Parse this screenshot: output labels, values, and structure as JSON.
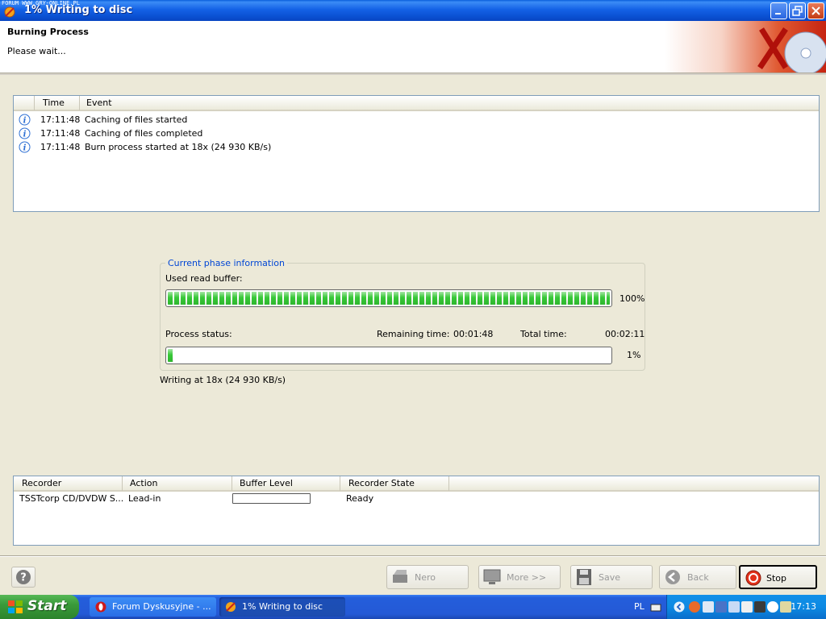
{
  "window": {
    "watermark": "FORUM WWW.GRY-ONLINE.PL",
    "title": "1% Writing to disc"
  },
  "header": {
    "title": "Burning Process",
    "subtitle": "Please wait..."
  },
  "event_log": {
    "columns": [
      "Time",
      "Event"
    ],
    "rows": [
      {
        "icon": "info-icon",
        "time": "17:11:48",
        "event": "Caching of files started"
      },
      {
        "icon": "info-icon",
        "time": "17:11:48",
        "event": "Caching of files completed"
      },
      {
        "icon": "info-icon",
        "time": "17:11:48",
        "event": "Burn process started at 18x (24 930 KB/s)"
      }
    ]
  },
  "phase": {
    "legend": "Current phase information",
    "buffer_label": "Used read buffer:",
    "buffer_percent_text": "100%",
    "buffer_fraction": 1.0,
    "status_label": "Process status:",
    "remaining_label": "Remaining time:",
    "remaining_value": "00:01:48",
    "total_label": "Total time:",
    "total_value": "00:02:11",
    "process_percent_text": "1%",
    "process_fraction": 0.01,
    "writing_text": "Writing at 18x (24 930 KB/s)"
  },
  "recorders": {
    "columns": [
      "Recorder",
      "Action",
      "Buffer Level",
      "Recorder State"
    ],
    "rows": [
      {
        "recorder": "TSSTcorp CD/DVDW S...",
        "action": "Lead-in",
        "buffer_fraction": 0,
        "state": "Ready"
      }
    ]
  },
  "buttons": {
    "nero": "Nero",
    "more": "More >>",
    "save": "Save",
    "back": "Back",
    "stop": "Stop"
  },
  "taskbar": {
    "start": "Start",
    "tasks": [
      {
        "label": "Forum Dyskusyjne - ...",
        "icon": "opera-icon"
      },
      {
        "label": "1% Writing to disc",
        "icon": "nero-icon"
      }
    ],
    "language": "PL",
    "clock": "17:13"
  },
  "colors": {
    "progress_green": "#37c837",
    "title_bar": "#0a4fd1",
    "taskbar": "#245edb",
    "legend_blue": "#0046d5"
  }
}
